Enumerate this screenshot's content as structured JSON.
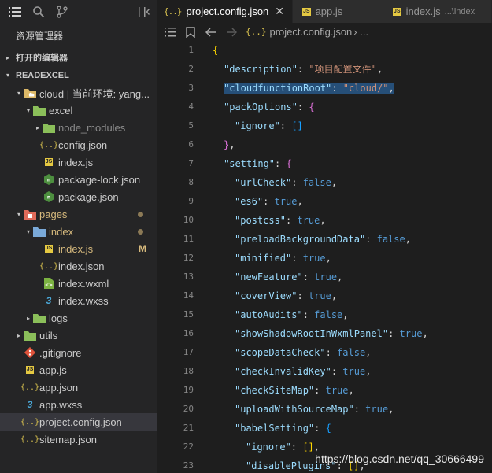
{
  "sidebar": {
    "title": "资源管理器",
    "open_editors_label": "打开的编辑器",
    "root_label": "READEXCEL",
    "tree": [
      {
        "name": "cloud-folder",
        "label": "cloud | 当前环境: yang...",
        "depth": 1,
        "twisty": "▾",
        "icon": "folder-cloud",
        "dim": false
      },
      {
        "name": "excel-folder",
        "label": "excel",
        "depth": 2,
        "twisty": "▾",
        "icon": "folder-green",
        "dim": false
      },
      {
        "name": "node-modules-folder",
        "label": "node_modules",
        "depth": 3,
        "twisty": "▸",
        "icon": "folder-green",
        "dim": true
      },
      {
        "name": "config-json-file",
        "label": "config.json",
        "depth": 3,
        "twisty": "",
        "icon": "json",
        "dim": false
      },
      {
        "name": "excel-index-js-file",
        "label": "index.js",
        "depth": 3,
        "twisty": "",
        "icon": "js",
        "dim": false
      },
      {
        "name": "package-lock-json-file",
        "label": "package-lock.json",
        "depth": 3,
        "twisty": "",
        "icon": "npm",
        "dim": false
      },
      {
        "name": "package-json-file",
        "label": "package.json",
        "depth": 3,
        "twisty": "",
        "icon": "npm",
        "dim": false
      },
      {
        "name": "pages-folder",
        "label": "pages",
        "depth": 1,
        "twisty": "▾",
        "icon": "folder-red",
        "dim": false,
        "mod": true,
        "dot": true
      },
      {
        "name": "index-folder",
        "label": "index",
        "depth": 2,
        "twisty": "▾",
        "icon": "folder-blue",
        "dim": false,
        "mod": true,
        "dot": true
      },
      {
        "name": "pages-index-js-file",
        "label": "index.js",
        "depth": 3,
        "twisty": "",
        "icon": "js",
        "dim": false,
        "mod": true,
        "badge": "M"
      },
      {
        "name": "index-json-file",
        "label": "index.json",
        "depth": 3,
        "twisty": "",
        "icon": "json",
        "dim": false
      },
      {
        "name": "index-wxml-file",
        "label": "index.wxml",
        "depth": 3,
        "twisty": "",
        "icon": "wxml",
        "dim": false
      },
      {
        "name": "index-wxss-file",
        "label": "index.wxss",
        "depth": 3,
        "twisty": "",
        "icon": "css",
        "dim": false
      },
      {
        "name": "logs-folder",
        "label": "logs",
        "depth": 2,
        "twisty": "▸",
        "icon": "folder-green",
        "dim": false
      },
      {
        "name": "utils-folder",
        "label": "utils",
        "depth": 1,
        "twisty": "▸",
        "icon": "folder-green",
        "dim": false
      },
      {
        "name": "gitignore-file",
        "label": ".gitignore",
        "depth": 1,
        "twisty": "",
        "icon": "git",
        "dim": false
      },
      {
        "name": "app-js-file",
        "label": "app.js",
        "depth": 1,
        "twisty": "",
        "icon": "js",
        "dim": false
      },
      {
        "name": "app-json-file",
        "label": "app.json",
        "depth": 1,
        "twisty": "",
        "icon": "json",
        "dim": false
      },
      {
        "name": "app-wxss-file",
        "label": "app.wxss",
        "depth": 1,
        "twisty": "",
        "icon": "css",
        "dim": false
      },
      {
        "name": "project-config-json-file",
        "label": "project.config.json",
        "depth": 1,
        "twisty": "",
        "icon": "json",
        "dim": false,
        "selected": true
      },
      {
        "name": "sitemap-json-file",
        "label": "sitemap.json",
        "depth": 1,
        "twisty": "",
        "icon": "json",
        "dim": false
      }
    ]
  },
  "tabs": [
    {
      "label": "project.config.json",
      "icon": "json",
      "active": true,
      "close": "✕",
      "desc": ""
    },
    {
      "label": "app.js",
      "icon": "js",
      "active": false,
      "close": "",
      "desc": ""
    },
    {
      "label": "index.js",
      "icon": "js",
      "active": false,
      "close": "",
      "desc": "...\\index"
    }
  ],
  "breadcrumb": {
    "icon": "{..}",
    "file": "project.config.json",
    "more": "›  ..."
  },
  "code_lines": [
    {
      "n": "1",
      "indent": 0,
      "tokens": [
        [
          "br1",
          "{"
        ]
      ]
    },
    {
      "n": "2",
      "indent": 1,
      "tokens": [
        [
          "k",
          "\"description\""
        ],
        [
          "p",
          ": "
        ],
        [
          "s",
          "\"项目配置文件\""
        ],
        [
          "p",
          ","
        ]
      ]
    },
    {
      "n": "3",
      "indent": 1,
      "hl": true,
      "tokens": [
        [
          "k",
          "\"cloudfunctionRoot\""
        ],
        [
          "p",
          ": "
        ],
        [
          "s",
          "\"cloud/\""
        ],
        [
          "p",
          ","
        ]
      ]
    },
    {
      "n": "4",
      "indent": 1,
      "tokens": [
        [
          "k",
          "\"packOptions\""
        ],
        [
          "p",
          ": "
        ],
        [
          "br2",
          "{"
        ]
      ]
    },
    {
      "n": "5",
      "indent": 2,
      "tokens": [
        [
          "k",
          "\"ignore\""
        ],
        [
          "p",
          ": "
        ],
        [
          "br3",
          "[]"
        ]
      ]
    },
    {
      "n": "6",
      "indent": 1,
      "tokens": [
        [
          "br2",
          "}"
        ],
        [
          "p",
          ","
        ]
      ]
    },
    {
      "n": "7",
      "indent": 1,
      "tokens": [
        [
          "k",
          "\"setting\""
        ],
        [
          "p",
          ": "
        ],
        [
          "br2",
          "{"
        ]
      ]
    },
    {
      "n": "8",
      "indent": 2,
      "tokens": [
        [
          "k",
          "\"urlCheck\""
        ],
        [
          "p",
          ": "
        ],
        [
          "b",
          "false"
        ],
        [
          "p",
          ","
        ]
      ]
    },
    {
      "n": "9",
      "indent": 2,
      "tokens": [
        [
          "k",
          "\"es6\""
        ],
        [
          "p",
          ": "
        ],
        [
          "b",
          "true"
        ],
        [
          "p",
          ","
        ]
      ]
    },
    {
      "n": "10",
      "indent": 2,
      "tokens": [
        [
          "k",
          "\"postcss\""
        ],
        [
          "p",
          ": "
        ],
        [
          "b",
          "true"
        ],
        [
          "p",
          ","
        ]
      ]
    },
    {
      "n": "11",
      "indent": 2,
      "tokens": [
        [
          "k",
          "\"preloadBackgroundData\""
        ],
        [
          "p",
          ": "
        ],
        [
          "b",
          "false"
        ],
        [
          "p",
          ","
        ]
      ]
    },
    {
      "n": "12",
      "indent": 2,
      "tokens": [
        [
          "k",
          "\"minified\""
        ],
        [
          "p",
          ": "
        ],
        [
          "b",
          "true"
        ],
        [
          "p",
          ","
        ]
      ]
    },
    {
      "n": "13",
      "indent": 2,
      "tokens": [
        [
          "k",
          "\"newFeature\""
        ],
        [
          "p",
          ": "
        ],
        [
          "b",
          "true"
        ],
        [
          "p",
          ","
        ]
      ]
    },
    {
      "n": "14",
      "indent": 2,
      "tokens": [
        [
          "k",
          "\"coverView\""
        ],
        [
          "p",
          ": "
        ],
        [
          "b",
          "true"
        ],
        [
          "p",
          ","
        ]
      ]
    },
    {
      "n": "15",
      "indent": 2,
      "tokens": [
        [
          "k",
          "\"autoAudits\""
        ],
        [
          "p",
          ": "
        ],
        [
          "b",
          "false"
        ],
        [
          "p",
          ","
        ]
      ]
    },
    {
      "n": "16",
      "indent": 2,
      "tokens": [
        [
          "k",
          "\"showShadowRootInWxmlPanel\""
        ],
        [
          "p",
          ": "
        ],
        [
          "b",
          "true"
        ],
        [
          "p",
          ","
        ]
      ]
    },
    {
      "n": "17",
      "indent": 2,
      "tokens": [
        [
          "k",
          "\"scopeDataCheck\""
        ],
        [
          "p",
          ": "
        ],
        [
          "b",
          "false"
        ],
        [
          "p",
          ","
        ]
      ]
    },
    {
      "n": "18",
      "indent": 2,
      "tokens": [
        [
          "k",
          "\"checkInvalidKey\""
        ],
        [
          "p",
          ": "
        ],
        [
          "b",
          "true"
        ],
        [
          "p",
          ","
        ]
      ]
    },
    {
      "n": "19",
      "indent": 2,
      "tokens": [
        [
          "k",
          "\"checkSiteMap\""
        ],
        [
          "p",
          ": "
        ],
        [
          "b",
          "true"
        ],
        [
          "p",
          ","
        ]
      ]
    },
    {
      "n": "20",
      "indent": 2,
      "tokens": [
        [
          "k",
          "\"uploadWithSourceMap\""
        ],
        [
          "p",
          ": "
        ],
        [
          "b",
          "true"
        ],
        [
          "p",
          ","
        ]
      ]
    },
    {
      "n": "21",
      "indent": 2,
      "tokens": [
        [
          "k",
          "\"babelSetting\""
        ],
        [
          "p",
          ": "
        ],
        [
          "br3",
          "{"
        ]
      ]
    },
    {
      "n": "22",
      "indent": 3,
      "tokens": [
        [
          "k",
          "\"ignore\""
        ],
        [
          "p",
          ": "
        ],
        [
          "br1",
          "[]"
        ],
        [
          "p",
          ","
        ]
      ]
    },
    {
      "n": "23",
      "indent": 3,
      "tokens": [
        [
          "k",
          "\"disablePlugins\""
        ],
        [
          "p",
          ": "
        ],
        [
          "br1",
          "[]"
        ],
        [
          "p",
          ","
        ]
      ]
    }
  ],
  "watermark": "https://blog.csdn.net/qq_30666499",
  "colors": {
    "accent": "#007acc",
    "selection": "#264f78",
    "modified": "#d7ba7d"
  }
}
